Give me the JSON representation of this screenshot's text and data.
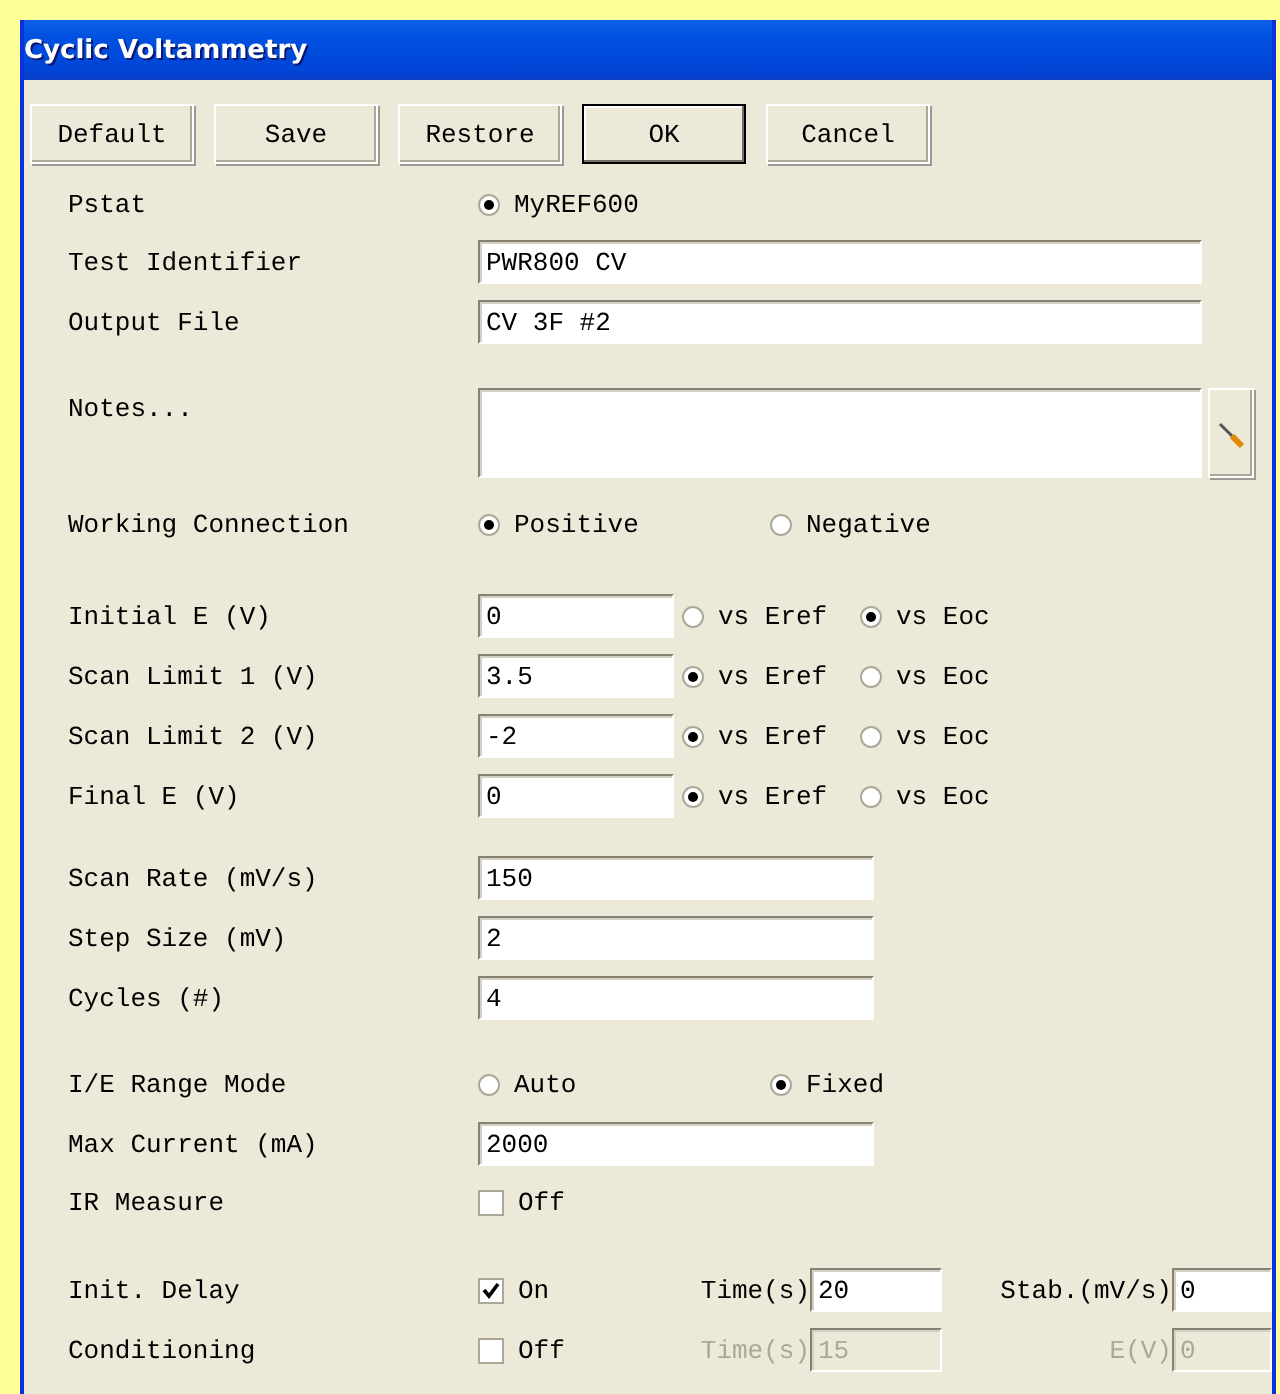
{
  "window": {
    "title": "Cyclic Voltammetry"
  },
  "buttons": [
    {
      "label": "Default",
      "default": false
    },
    {
      "label": "Save",
      "default": false
    },
    {
      "label": "Restore",
      "default": false
    },
    {
      "label": "OK",
      "default": true
    },
    {
      "label": "Cancel",
      "default": false
    }
  ],
  "pstat": {
    "label": "Pstat",
    "options": [
      {
        "label": "MyREF600",
        "selected": true
      }
    ]
  },
  "text_fields": [
    {
      "label": "Test Identifier",
      "value": "PWR800 CV"
    },
    {
      "label": "Output File",
      "value": "CV 3F #2"
    }
  ],
  "notes": {
    "label": "Notes..."
  },
  "working_connection": {
    "label": "Working Connection",
    "options": [
      {
        "label": "Positive",
        "selected": true
      },
      {
        "label": "Negative",
        "selected": false
      }
    ]
  },
  "potentials": [
    {
      "label": "Initial E (V)",
      "value": "0",
      "options": [
        {
          "label": "vs Eref",
          "selected": false
        },
        {
          "label": "vs Eoc",
          "selected": true
        }
      ]
    },
    {
      "label": "Scan Limit 1 (V)",
      "value": "3.5",
      "options": [
        {
          "label": "vs Eref",
          "selected": true
        },
        {
          "label": "vs Eoc",
          "selected": false
        }
      ]
    },
    {
      "label": "Scan Limit 2 (V)",
      "value": "-2",
      "options": [
        {
          "label": "vs Eref",
          "selected": true
        },
        {
          "label": "vs Eoc",
          "selected": false
        }
      ]
    },
    {
      "label": "Final E (V)",
      "value": "0",
      "options": [
        {
          "label": "vs Eref",
          "selected": true
        },
        {
          "label": "vs Eoc",
          "selected": false
        }
      ]
    }
  ],
  "scan_fields": [
    {
      "label": "Scan Rate (mV/s)",
      "value": "150"
    },
    {
      "label": "Step Size (mV)",
      "value": "2"
    },
    {
      "label": "Cycles (#)",
      "value": "4"
    }
  ],
  "range_mode": {
    "label": "I/E Range Mode",
    "options": [
      {
        "label": "Auto",
        "selected": false
      },
      {
        "label": "Fixed",
        "selected": true
      }
    ]
  },
  "max_current": {
    "label": "Max Current (mA)",
    "value": "2000"
  },
  "ir_measure": {
    "label": "IR Measure",
    "checked": false,
    "state_label": "Off"
  },
  "delays": [
    {
      "label": "Init. Delay",
      "checked": true,
      "state_label": "On",
      "disabled": false,
      "time_label": "Time(s)",
      "time_value": "20",
      "second_label": "Stab.(mV/s)",
      "second_value": "0"
    },
    {
      "label": "Conditioning",
      "checked": false,
      "state_label": "Off",
      "disabled": true,
      "time_label": "Time(s)",
      "time_value": "15",
      "second_label": "E(V)",
      "second_value": "0"
    }
  ]
}
